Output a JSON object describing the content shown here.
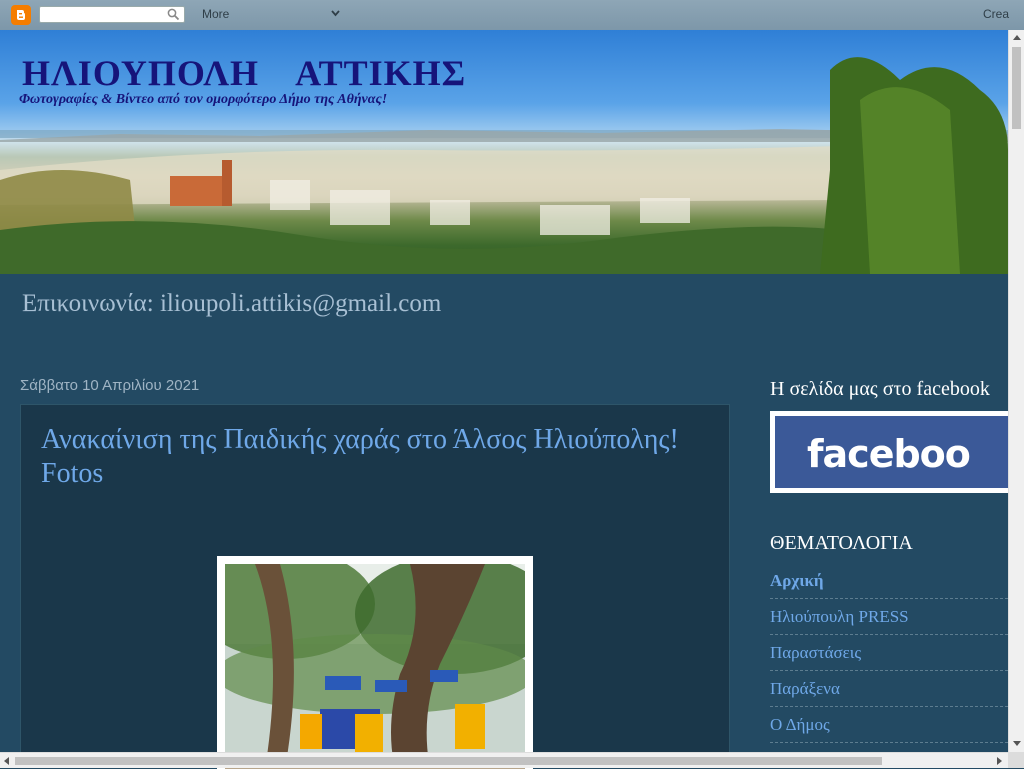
{
  "navbar": {
    "more_label": "More",
    "create_label": "Crea",
    "search_placeholder": ""
  },
  "header": {
    "title": "ΗΛΙΟΥΠΟΛΗ ΑΤΤΙΚΗΣ",
    "subtitle": "Φωτογραφίες & Βίντεο από τον ομορφότερο Δήμο της Αθήνας!"
  },
  "description": "Επικοινωνία: ilioupoli.attikis@gmail.com",
  "main": {
    "date": "Σάββατο 10 Απριλίου 2021",
    "post_title": "Ανακαίνιση της Παιδικής χαράς στο Άλσος Ηλιούπολης! Fotos"
  },
  "sidebar": {
    "facebook_heading": "Η σελίδα μας στο facebook",
    "facebook_badge_text": "faceboo",
    "categories_heading": "ΘΕΜΑΤΟΛΟΓΙΑ",
    "categories": [
      "Αρχική",
      "Ηλιούπουλη PRESS",
      "Παραστάσεις",
      "Παράξενα",
      "Ο Δήμος"
    ]
  },
  "colors": {
    "page_background": "#234a63",
    "link": "#6fa8e8",
    "title_text": "#16147a",
    "facebook_blue": "#3b5998",
    "blogger_orange": "#f57d00"
  }
}
